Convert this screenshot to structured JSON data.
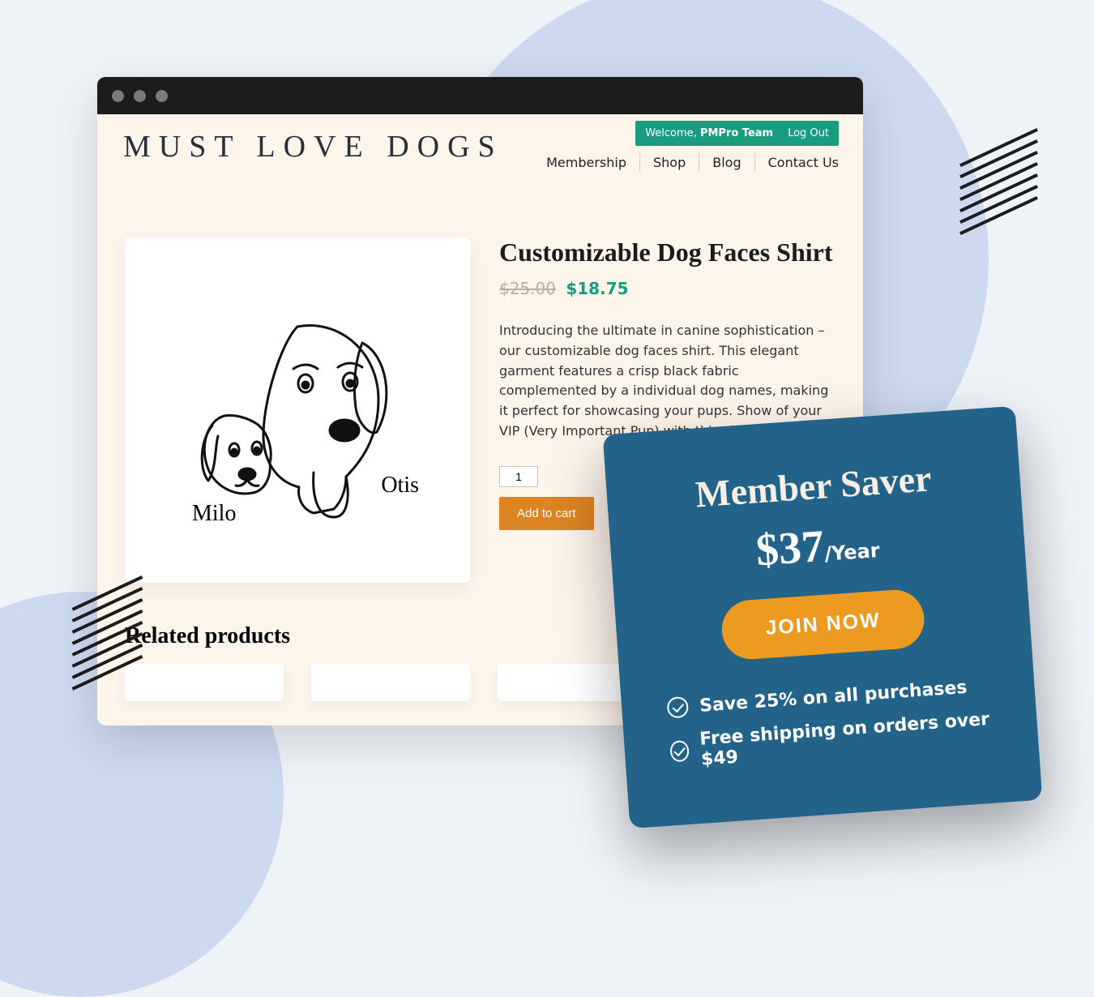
{
  "site": {
    "title": "MUST LOVE DOGS",
    "welcome_label": "Welcome, ",
    "welcome_name": "PMPro Team",
    "logout_label": "Log Out",
    "nav": [
      "Membership",
      "Shop",
      "Blog",
      "Contact Us"
    ]
  },
  "product": {
    "title": "Customizable Dog Faces Shirt",
    "price_old": "$25.00",
    "price_new": "$18.75",
    "description": "Introducing the ultimate in canine sophistication – our customizable dog faces shirt. This elegant garment features a crisp black fabric complemented by a individual dog names, making it perfect for showcasing your pups. Show of your VIP (Very Important Pup) with this shirt.",
    "quantity_value": "1",
    "add_to_cart_label": "Add to cart",
    "dog_name_left": "Milo",
    "dog_name_right": "Otis"
  },
  "related": {
    "title": "Related products"
  },
  "popup": {
    "title": "Member Saver",
    "price": "$37",
    "period": "/Year",
    "cta_label": "JOIN NOW",
    "benefit_1": "Save 25% on all purchases",
    "benefit_2": "Free shipping on orders over $49"
  },
  "colors": {
    "brand_teal": "#1a9c7e",
    "accent_orange": "#dd8522",
    "popup_bg": "#236389",
    "popup_cta": "#ed9a21"
  }
}
